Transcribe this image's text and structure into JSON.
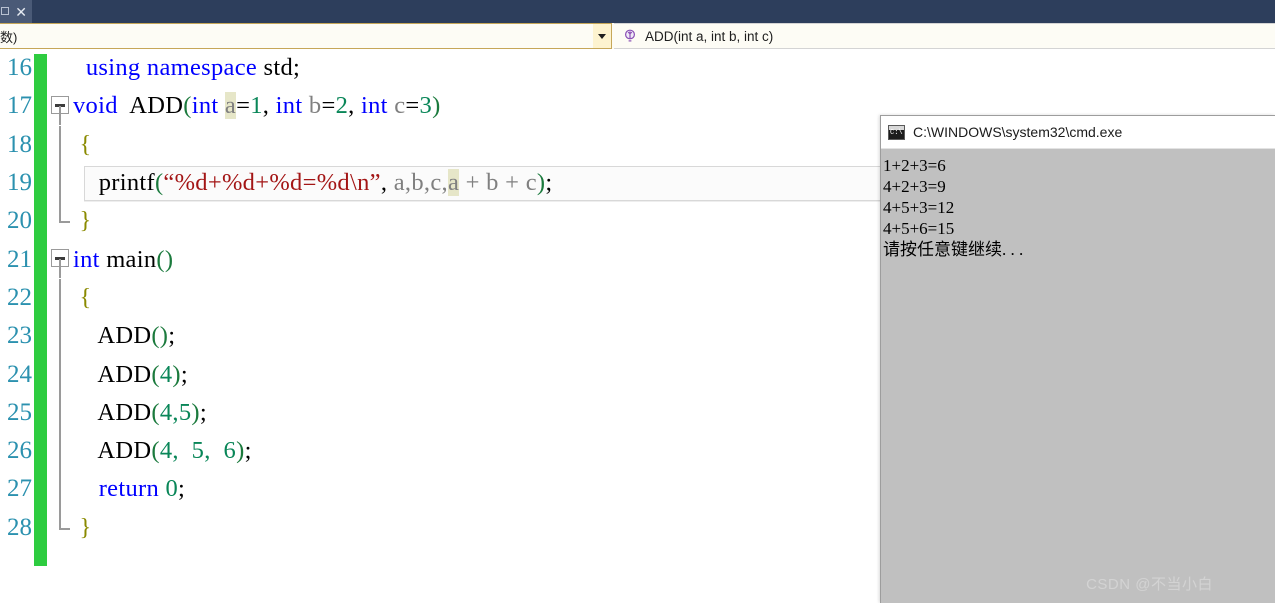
{
  "window": {
    "tab": {
      "close_label": "✕",
      "restore_icon": "restore-icon"
    }
  },
  "navbar": {
    "left_combo": {
      "value": "数)",
      "dropdown_icon": "chevron-down-icon"
    },
    "right_combo": {
      "value": "ADD(int a, int b, int c)",
      "icon": "method-icon"
    }
  },
  "editor": {
    "first_line_number": 16,
    "lines": [
      {
        "num": "16",
        "fold": "none",
        "indent": "  ",
        "tokens": [
          {
            "t": "using namespace std;",
            "c": "ns"
          }
        ]
      },
      {
        "num": "17",
        "fold": "open",
        "indent": "",
        "tokens": [
          {
            "t": "void",
            "c": "kw"
          },
          {
            "t": "  ",
            "c": "plain"
          },
          {
            "t": "ADD",
            "c": "plain"
          },
          {
            "t": "(",
            "c": "paren"
          },
          {
            "t": "int",
            "c": "kw"
          },
          {
            "t": " ",
            "c": "plain"
          },
          {
            "t": "a",
            "c": "param hl"
          },
          {
            "t": "=",
            "c": "plain"
          },
          {
            "t": "1",
            "c": "num"
          },
          {
            "t": ",",
            "c": "plain"
          },
          {
            "t": " ",
            "c": "plain"
          },
          {
            "t": "int",
            "c": "kw"
          },
          {
            "t": " ",
            "c": "plain"
          },
          {
            "t": "b",
            "c": "param"
          },
          {
            "t": "=",
            "c": "plain"
          },
          {
            "t": "2",
            "c": "num"
          },
          {
            "t": ",",
            "c": "plain"
          },
          {
            "t": " ",
            "c": "plain"
          },
          {
            "t": "int",
            "c": "kw"
          },
          {
            "t": " ",
            "c": "plain"
          },
          {
            "t": "c",
            "c": "param"
          },
          {
            "t": "=",
            "c": "plain"
          },
          {
            "t": "3",
            "c": "num"
          },
          {
            "t": ")",
            "c": "paren"
          }
        ]
      },
      {
        "num": "18",
        "fold": "line",
        "indent": " ",
        "tokens": [
          {
            "t": "{",
            "c": "brace"
          }
        ]
      },
      {
        "num": "19",
        "fold": "line",
        "indent": "    ",
        "current": true,
        "tokens": [
          {
            "t": "printf",
            "c": "plain"
          },
          {
            "t": "(",
            "c": "paren"
          },
          {
            "t": "“%d+%d+%d=%d\\n”",
            "c": "str"
          },
          {
            "t": ",",
            "c": "plain"
          },
          {
            "t": " ",
            "c": "plain"
          },
          {
            "t": "a",
            "c": "param"
          },
          {
            "t": ",",
            "c": "param"
          },
          {
            "t": "b",
            "c": "param"
          },
          {
            "t": ",",
            "c": "param"
          },
          {
            "t": "c",
            "c": "param"
          },
          {
            "t": ",",
            "c": "param"
          },
          {
            "t": "a",
            "c": "param hl"
          },
          {
            "t": " ",
            "c": "plain"
          },
          {
            "t": "+",
            "c": "param"
          },
          {
            "t": " ",
            "c": "plain"
          },
          {
            "t": "b",
            "c": "param"
          },
          {
            "t": " ",
            "c": "plain"
          },
          {
            "t": "+",
            "c": "param"
          },
          {
            "t": " ",
            "c": "plain"
          },
          {
            "t": "c",
            "c": "param"
          },
          {
            "t": ")",
            "c": "paren"
          },
          {
            "t": ";",
            "c": "plain"
          }
        ]
      },
      {
        "num": "20",
        "fold": "end",
        "indent": " ",
        "tokens": [
          {
            "t": "}",
            "c": "brace"
          }
        ]
      },
      {
        "num": "21",
        "fold": "open",
        "indent": "",
        "tokens": [
          {
            "t": "int",
            "c": "kw"
          },
          {
            "t": " main",
            "c": "plain"
          },
          {
            "t": "()",
            "c": "paren"
          }
        ]
      },
      {
        "num": "22",
        "fold": "line",
        "indent": " ",
        "tokens": [
          {
            "t": "{",
            "c": "brace"
          }
        ]
      },
      {
        "num": "23",
        "fold": "line",
        "indent": "    ",
        "tokens": [
          {
            "t": "ADD",
            "c": "plain"
          },
          {
            "t": "()",
            "c": "paren"
          },
          {
            "t": ";",
            "c": "plain"
          }
        ]
      },
      {
        "num": "24",
        "fold": "line",
        "indent": "    ",
        "tokens": [
          {
            "t": "ADD",
            "c": "plain"
          },
          {
            "t": "(",
            "c": "paren"
          },
          {
            "t": "4",
            "c": "num"
          },
          {
            "t": ")",
            "c": "paren"
          },
          {
            "t": ";",
            "c": "plain"
          }
        ]
      },
      {
        "num": "25",
        "fold": "line",
        "indent": "    ",
        "tokens": [
          {
            "t": "ADD",
            "c": "plain"
          },
          {
            "t": "(",
            "c": "paren"
          },
          {
            "t": "4",
            "c": "num"
          },
          {
            "t": ",",
            "c": "num"
          },
          {
            "t": "5",
            "c": "num"
          },
          {
            "t": ")",
            "c": "paren"
          },
          {
            "t": ";",
            "c": "plain"
          }
        ]
      },
      {
        "num": "26",
        "fold": "line",
        "indent": "    ",
        "tokens": [
          {
            "t": "ADD",
            "c": "plain"
          },
          {
            "t": "(",
            "c": "paren"
          },
          {
            "t": "4",
            "c": "num"
          },
          {
            "t": ",",
            "c": "num"
          },
          {
            "t": "  ",
            "c": "plain"
          },
          {
            "t": "5",
            "c": "num"
          },
          {
            "t": ",",
            "c": "num"
          },
          {
            "t": "  ",
            "c": "plain"
          },
          {
            "t": "6",
            "c": "num"
          },
          {
            "t": ")",
            "c": "paren"
          },
          {
            "t": ";",
            "c": "plain"
          }
        ]
      },
      {
        "num": "27",
        "fold": "line",
        "indent": "    ",
        "tokens": [
          {
            "t": "return",
            "c": "kw"
          },
          {
            "t": " ",
            "c": "plain"
          },
          {
            "t": "0",
            "c": "num"
          },
          {
            "t": ";",
            "c": "plain"
          }
        ]
      },
      {
        "num": "28",
        "fold": "end",
        "indent": " ",
        "tokens": [
          {
            "t": "}",
            "c": "brace"
          }
        ]
      }
    ]
  },
  "console": {
    "title": "C:\\WINDOWS\\system32\\cmd.exe",
    "icon": "cmd-icon",
    "output": [
      "1+2+3=6",
      "4+2+3=9",
      "4+5+3=12",
      "4+5+6=15",
      "请按任意键继续. . ."
    ]
  },
  "watermark": {
    "text": "CSDN @不当小白"
  },
  "colors": {
    "tabstrip_bg": "#2d3e5c",
    "tab_active_bg": "#4a5a77",
    "navbar_bg": "#fdfcf5",
    "navbar_border": "#c6a759",
    "change_marker": "#2ecc40",
    "line_number": "#2b91af",
    "keyword": "#0000ff",
    "string": "#a31515",
    "number": "#098658",
    "paren": "#1b7a3d",
    "param": "#808080",
    "brace": "#8a8a00",
    "highlight": "#e6e6c8",
    "console_bg": "#c0c0c0"
  }
}
